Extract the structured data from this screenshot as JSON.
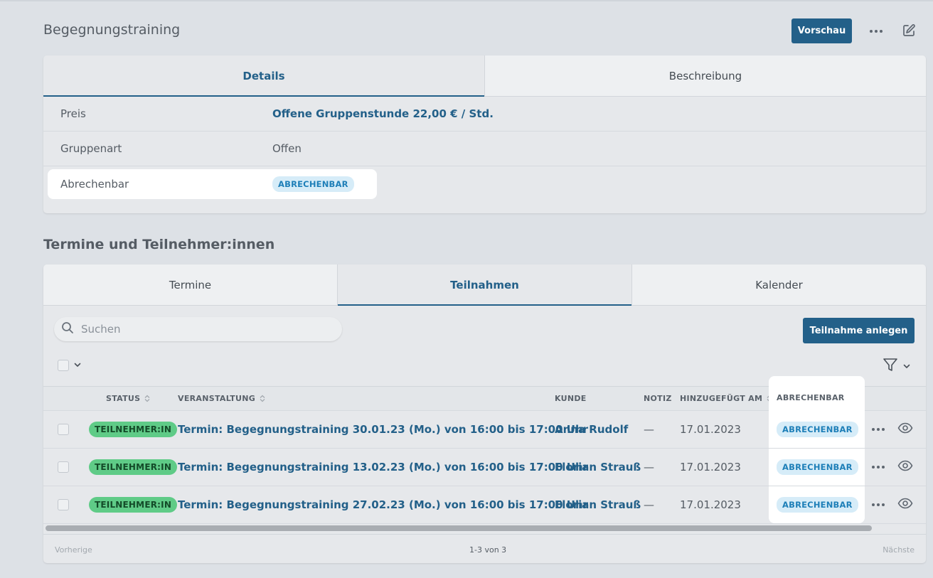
{
  "header": {
    "title": "Begegnungstraining",
    "preview_label": "Vorschau"
  },
  "details": {
    "tabs": [
      {
        "label": "Details",
        "active": true
      },
      {
        "label": "Beschreibung",
        "active": false
      }
    ],
    "rows": [
      {
        "label": "Preis",
        "value": "Offene Gruppenstunde 22,00 € / Std."
      },
      {
        "label": "Gruppenart",
        "value": "Offen"
      },
      {
        "label": "Abrechenbar",
        "badge": "ABRECHENBAR"
      }
    ]
  },
  "participants": {
    "section_title": "Termine und Teilnehmer:innen",
    "tabs": [
      {
        "label": "Termine",
        "active": false
      },
      {
        "label": "Teilnahmen",
        "active": true
      },
      {
        "label": "Kalender",
        "active": false
      }
    ],
    "search_placeholder": "Suchen",
    "add_label": "Teilnahme anlegen",
    "columns": {
      "status": "STATUS",
      "event": "VERANSTALTUNG",
      "customer": "KUNDE",
      "note": "NOTIZ",
      "added": "HINZUGEFÜGT AM",
      "billable": "ABRECHENBAR"
    },
    "rows": [
      {
        "status": "TEILNEHMER:IN",
        "event": "Termin: Begegnungstraining 30.01.23 (Mo.) von 16:00 bis 17:00 Uhr",
        "customer": "Anna Rudolf",
        "note": "—",
        "added": "17.01.2023",
        "billable": "ABRECHENBAR"
      },
      {
        "status": "TEILNEHMER:IN",
        "event": "Termin: Begegnungstraining 13.02.23 (Mo.) von 16:00 bis 17:00 Uhr",
        "customer": "Florian Strauß",
        "note": "—",
        "added": "17.01.2023",
        "billable": "ABRECHENBAR"
      },
      {
        "status": "TEILNEHMER:IN",
        "event": "Termin: Begegnungstraining 27.02.23 (Mo.) von 16:00 bis 17:00 Uhr",
        "customer": "Florian Strauß",
        "note": "—",
        "added": "17.01.2023",
        "billable": "ABRECHENBAR"
      }
    ],
    "pagination": {
      "prev": "Vorherige",
      "count": "1-3 von 3",
      "next": "Nächste"
    }
  },
  "colors": {
    "primary": "#236089",
    "badge_green": "#5fcb87",
    "badge_blue_bg": "#d6ecf8",
    "badge_blue_text": "#1e7fb8",
    "background": "#dde1e6"
  }
}
